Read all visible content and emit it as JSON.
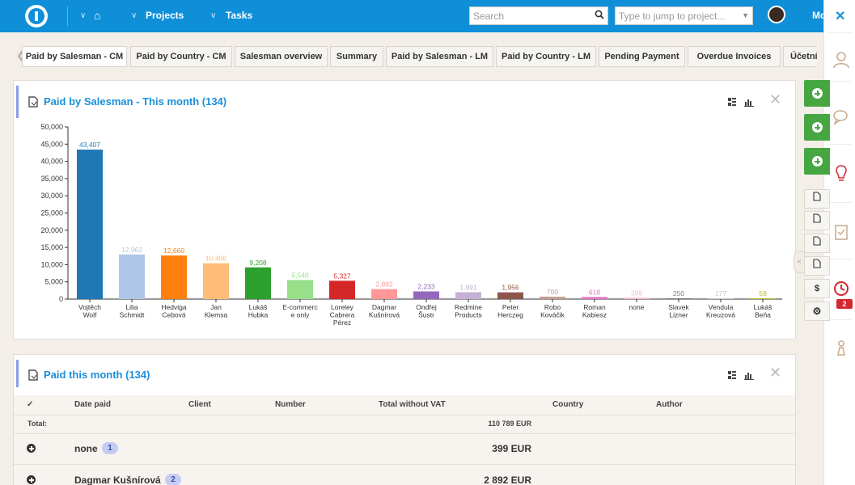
{
  "topbar": {
    "nav_projects": "Projects",
    "nav_tasks": "Tasks",
    "search_placeholder": "Search",
    "jump_placeholder": "Type to jump to project...",
    "user_name": "Mo",
    "home_icon": "home-icon",
    "brand_color": "#0f8fd8"
  },
  "tabs": [
    {
      "label": "Paid by Salesman - CM",
      "active": true
    },
    {
      "label": "Paid by Country - CM"
    },
    {
      "label": "Salesman overview"
    },
    {
      "label": "Summary"
    },
    {
      "label": "Paid by Salesman - LM"
    },
    {
      "label": "Paid by Country - LM"
    },
    {
      "label": "Pending Payment"
    },
    {
      "label": "Overdue Invoices"
    },
    {
      "label": "Účetní"
    }
  ],
  "chart_widget": {
    "title": "Paid by Salesman - This month (134)"
  },
  "chart_data": {
    "type": "bar",
    "categories": [
      "Vojtěch Wolf",
      "Lilia Schmidt",
      "Hedviga Cebová",
      "Jan Klemsa",
      "Lukáš Hubka",
      "E-commerce only",
      "Loreley Cabrera Pérez",
      "Dagmar Kušnírová",
      "Ondřej Šustr",
      "Redmine Products",
      "Peter Herczeg",
      "Robo Kováčik",
      "Roman Kabiesz",
      "none",
      "Slavek Lizner",
      "Vendula Kreuzová",
      "Lukáš Beňa"
    ],
    "category_lines": [
      [
        "Vojtěch",
        "Wolf"
      ],
      [
        "Lilia",
        "Schmidt"
      ],
      [
        "Hedviga",
        "Cebová"
      ],
      [
        "Jan",
        "Klemsa"
      ],
      [
        "Lukáš",
        "Hubka"
      ],
      [
        "E-commerc",
        "e only"
      ],
      [
        "Loreley",
        "Cabrera",
        "Pérez"
      ],
      [
        "Dagmar",
        "Kušnírová"
      ],
      [
        "Ondřej",
        "Šustr"
      ],
      [
        "Redmine",
        "Products"
      ],
      [
        "Peter",
        "Herczeg"
      ],
      [
        "Robo",
        "Kováčik"
      ],
      [
        "Roman",
        "Kabiesz"
      ],
      [
        "none"
      ],
      [
        "Slavek",
        "Lizner"
      ],
      [
        "Vendula",
        "Kreuzová"
      ],
      [
        "Lukáš",
        "Beňa"
      ]
    ],
    "values": [
      43407,
      12962,
      12660,
      10406,
      9208,
      5540,
      5327,
      2892,
      2233,
      1991,
      1956,
      700,
      618,
      399,
      250,
      177,
      59
    ],
    "value_labels": [
      "43,407",
      "12,962",
      "12,660",
      "10,406",
      "9,208",
      "5,540",
      "5,327",
      "2,892",
      "2,233",
      "1,991",
      "1,956",
      "700",
      "618",
      "399",
      "250",
      "177",
      "59"
    ],
    "colors": [
      "#1f77b4",
      "#aec7e8",
      "#ff7f0e",
      "#ffbb78",
      "#2ca02c",
      "#98df8a",
      "#d62728",
      "#ff9896",
      "#9467bd",
      "#c5b0d5",
      "#8c564b",
      "#c49c94",
      "#e377c2",
      "#f7b6d2",
      "#7f7f7f",
      "#c7c7c7",
      "#bcbd22"
    ],
    "yticks": [
      "0",
      "5,000",
      "10,000",
      "15,000",
      "20,000",
      "25,000",
      "30,000",
      "35,000",
      "40,000",
      "45,000",
      "50,000"
    ],
    "ylim": [
      0,
      50000
    ]
  },
  "table_widget": {
    "title": "Paid this month (134)",
    "headers": {
      "check": "✓",
      "date_paid": "Date paid",
      "client": "Client",
      "number": "Number",
      "total_without_vat": "Total without VAT",
      "country": "Country",
      "author": "Author"
    },
    "total_label": "Total:",
    "total_value": "110 789 EUR",
    "groups": [
      {
        "name": "none",
        "count": "1",
        "total": "399 EUR"
      },
      {
        "name": "Dagmar Kušnírová",
        "count": "2",
        "total": "2 892 EUR"
      }
    ]
  },
  "side_actions": {
    "dollar": "$"
  },
  "right_sidebar": {
    "clock_badge": "2"
  }
}
